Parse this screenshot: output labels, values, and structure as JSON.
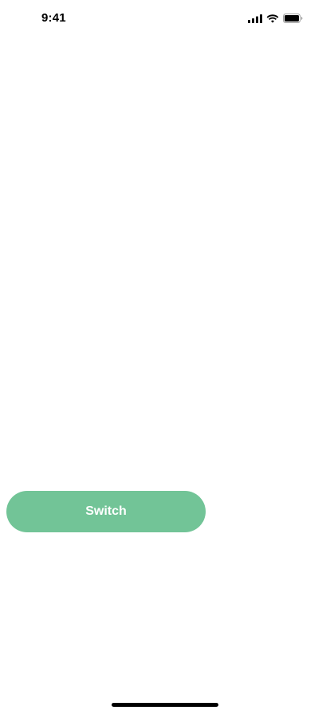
{
  "status_bar": {
    "time": "9:41",
    "icons": [
      "cellular-signal-icon",
      "wifi-icon",
      "battery-icon"
    ]
  },
  "switch_button": {
    "label": "Switch",
    "color": "#72C497",
    "text_color": "#ffffff"
  },
  "home_indicator": {
    "color": "#000000"
  }
}
